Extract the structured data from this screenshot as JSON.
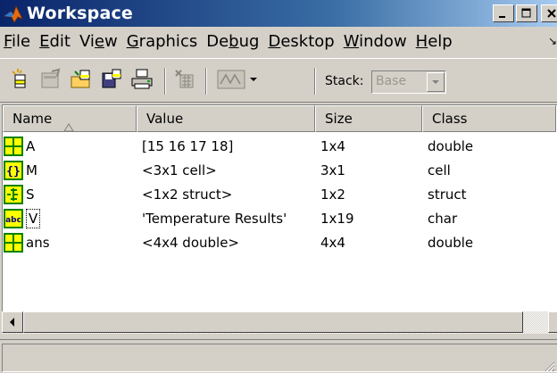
{
  "window": {
    "title": "Workspace",
    "buttons": {
      "minimize": "_",
      "maximize": "□",
      "close": "×"
    }
  },
  "menu": {
    "items": [
      {
        "label": "File",
        "ul": "F",
        "rest": "ile"
      },
      {
        "label": "Edit",
        "ul": "E",
        "rest": "dit"
      },
      {
        "label": "View",
        "pre": "Vi",
        "ul": "e",
        "rest": "w"
      },
      {
        "label": "Graphics",
        "ul": "G",
        "rest": "raphics"
      },
      {
        "label": "Debug",
        "pre": "De",
        "ul": "b",
        "rest": "ug"
      },
      {
        "label": "Desktop",
        "ul": "D",
        "rest": "esktop"
      },
      {
        "label": "Window",
        "ul": "W",
        "rest": "indow"
      },
      {
        "label": "Help",
        "ul": "H",
        "rest": "elp"
      }
    ],
    "overflow_arrow": "↘"
  },
  "toolbar": {
    "buttons": [
      {
        "name": "new-variable-icon"
      },
      {
        "name": "open-selection-icon"
      },
      {
        "name": "load-data-icon"
      },
      {
        "name": "save-icon"
      },
      {
        "name": "print-icon"
      },
      {
        "name": "delete-icon"
      },
      {
        "name": "plot-selection-icon"
      }
    ],
    "stack_label": "Stack:",
    "stack_value": "Base"
  },
  "table": {
    "columns": [
      "Name",
      "Value",
      "Size",
      "Class"
    ],
    "sort_indicator": "△",
    "rows": [
      {
        "icon": "matrix-icon",
        "name": "A",
        "value": "[15 16 17 18]",
        "size": "1x4",
        "class": "double"
      },
      {
        "icon": "cell-array-icon",
        "name": "M",
        "value": "<3x1 cell>",
        "size": "3x1",
        "class": "cell"
      },
      {
        "icon": "struct-icon",
        "name": "S",
        "value": "<1x2 struct>",
        "size": "1x2",
        "class": "struct"
      },
      {
        "icon": "char-array-icon",
        "name": "V",
        "value": "'Temperature Results'",
        "size": "1x19",
        "class": "char"
      },
      {
        "icon": "matrix-icon",
        "name": "ans",
        "value": "<4x4 double>",
        "size": "4x4",
        "class": "double"
      }
    ]
  },
  "colors": {
    "title_gradient_start": "#0a246a",
    "title_gradient_end": "#a6caf0",
    "chrome": "#d4d0c8",
    "icon_yellow": "#ffff00",
    "icon_green": "#008000"
  }
}
